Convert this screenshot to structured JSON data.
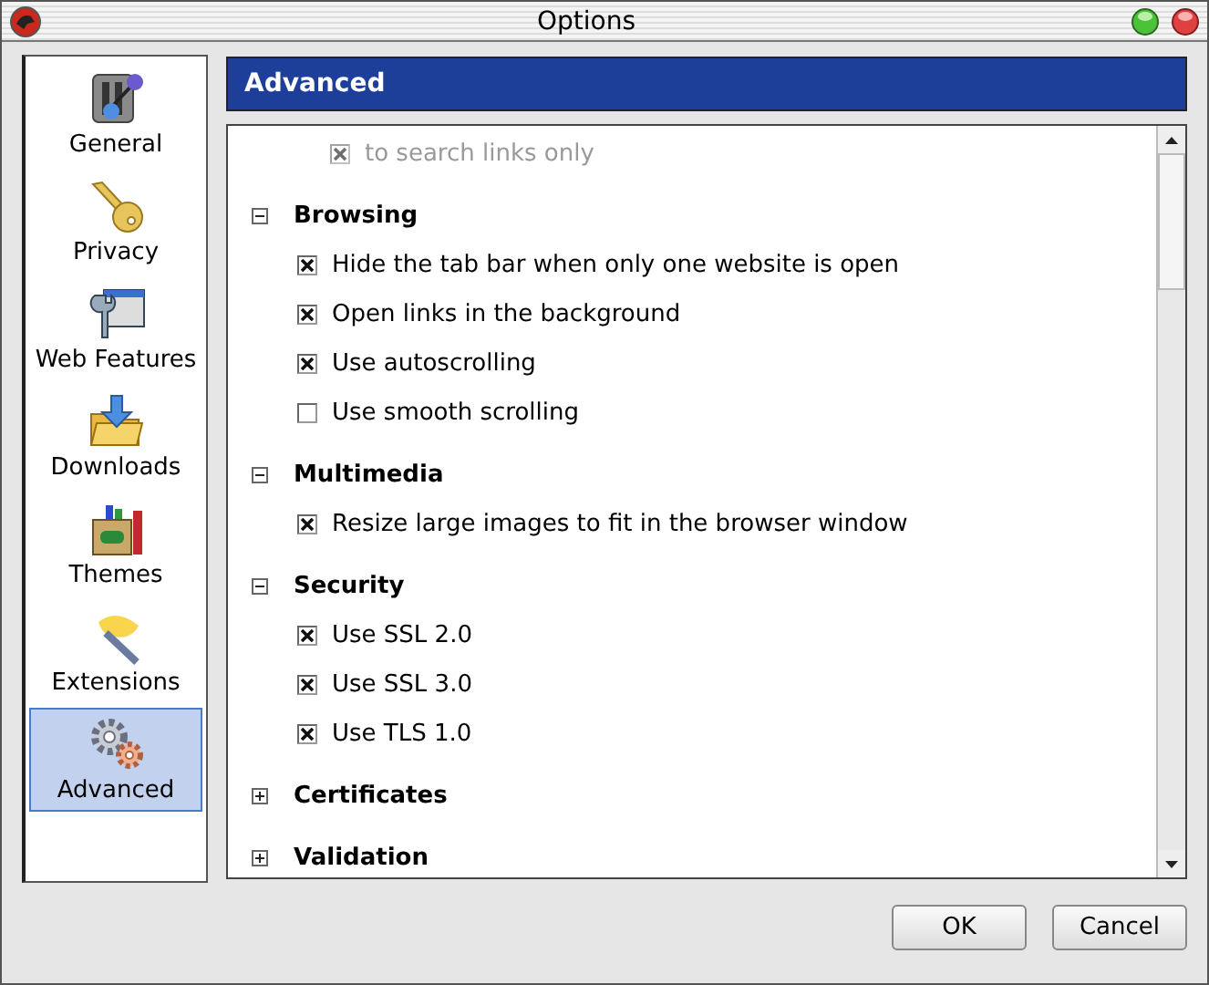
{
  "window": {
    "title": "Options"
  },
  "sidebar": {
    "items": [
      {
        "label": "General",
        "selected": false
      },
      {
        "label": "Privacy",
        "selected": false
      },
      {
        "label": "Web Features",
        "selected": false
      },
      {
        "label": "Downloads",
        "selected": false
      },
      {
        "label": "Themes",
        "selected": false
      },
      {
        "label": "Extensions",
        "selected": false
      },
      {
        "label": "Advanced",
        "selected": true
      }
    ]
  },
  "panel": {
    "title": "Advanced",
    "leading_items": [
      {
        "label": "to search links only",
        "checked": true,
        "disabled": true
      }
    ],
    "sections": [
      {
        "title": "Browsing",
        "expanded": true,
        "items": [
          {
            "label": "Hide the tab bar when only one website is open",
            "checked": true,
            "disabled": false
          },
          {
            "label": "Open links in the background",
            "checked": true,
            "disabled": false
          },
          {
            "label": "Use autoscrolling",
            "checked": true,
            "disabled": false
          },
          {
            "label": "Use smooth scrolling",
            "checked": false,
            "disabled": false
          }
        ]
      },
      {
        "title": "Multimedia",
        "expanded": true,
        "items": [
          {
            "label": "Resize large images to fit in the browser window",
            "checked": true,
            "disabled": false
          }
        ]
      },
      {
        "title": "Security",
        "expanded": true,
        "items": [
          {
            "label": "Use SSL 2.0",
            "checked": true,
            "disabled": false
          },
          {
            "label": "Use SSL 3.0",
            "checked": true,
            "disabled": false
          },
          {
            "label": "Use TLS 1.0",
            "checked": true,
            "disabled": false
          }
        ]
      },
      {
        "title": "Certificates",
        "expanded": false
      },
      {
        "title": "Validation",
        "expanded": false
      }
    ]
  },
  "buttons": [
    "OK",
    "Cancel"
  ]
}
